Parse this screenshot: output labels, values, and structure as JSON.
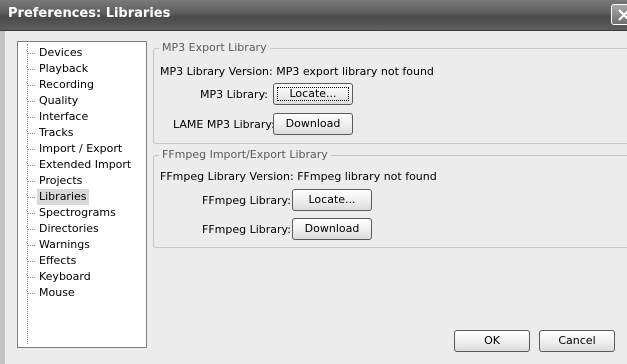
{
  "window": {
    "title": "Preferences: Libraries"
  },
  "tree": {
    "items": [
      {
        "label": "Devices"
      },
      {
        "label": "Playback"
      },
      {
        "label": "Recording"
      },
      {
        "label": "Quality"
      },
      {
        "label": "Interface"
      },
      {
        "label": "Tracks"
      },
      {
        "label": "Import / Export"
      },
      {
        "label": "Extended Import"
      },
      {
        "label": "Projects"
      },
      {
        "label": "Libraries",
        "selected": true
      },
      {
        "label": "Spectrograms"
      },
      {
        "label": "Directories"
      },
      {
        "label": "Warnings"
      },
      {
        "label": "Effects"
      },
      {
        "label": "Keyboard"
      },
      {
        "label": "Mouse"
      }
    ]
  },
  "mp3": {
    "group_title": "MP3 Export Library",
    "version_text": "MP3 Library Version: MP3 export library not found",
    "library_label": "MP3 Library:",
    "locate_button": "Locate...",
    "lame_label": "LAME MP3 Library:",
    "download_button": "Download"
  },
  "ffmpeg": {
    "group_title": "FFmpeg Import/Export Library",
    "version_text": "FFmpeg Library Version: FFmpeg library not found",
    "library_label": "FFmpeg Library:",
    "locate_button": "Locate...",
    "library_label_2": "FFmpeg Library:",
    "download_button": "Download"
  },
  "footer": {
    "ok_button": "OK",
    "cancel_button": "Cancel"
  }
}
